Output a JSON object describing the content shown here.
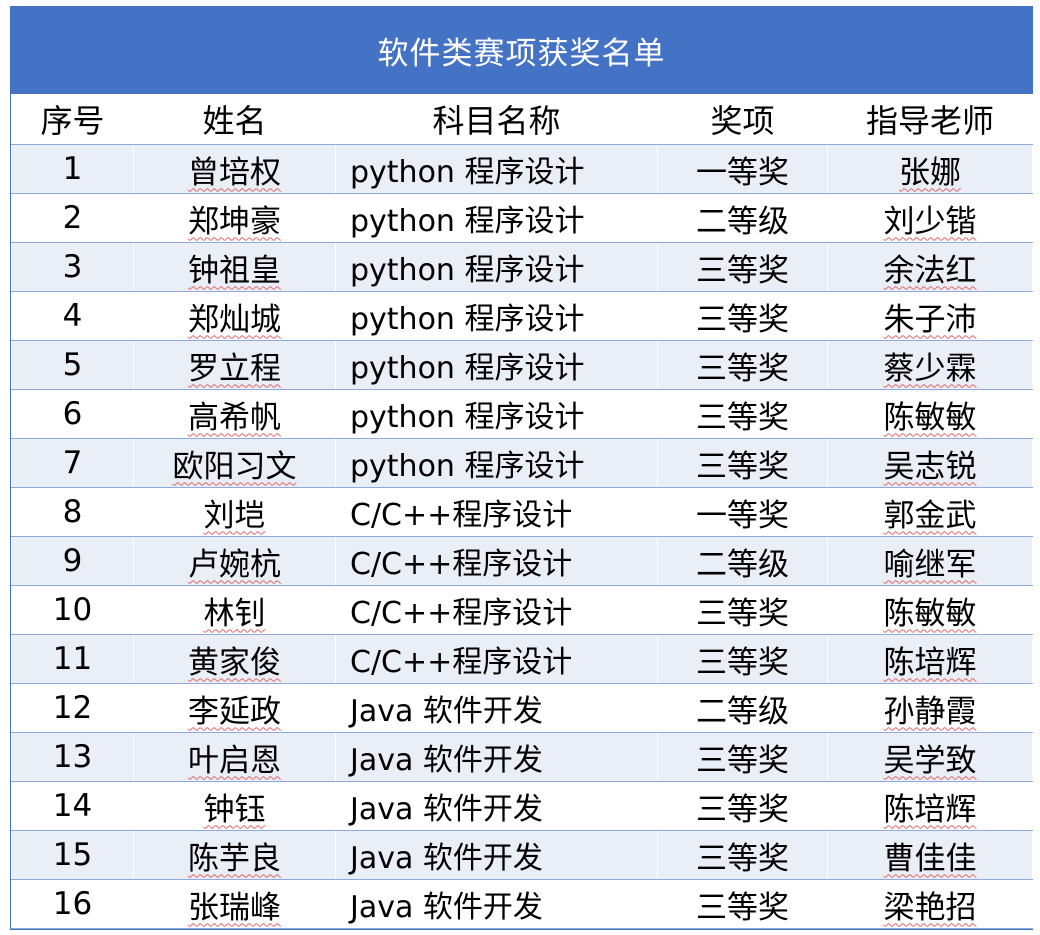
{
  "title": "软件类赛项获奖名单",
  "headers": [
    "序号",
    "姓名",
    "科目名称",
    "奖项",
    "指导老师"
  ],
  "rows": [
    {
      "no": "1",
      "name": "曾培权",
      "subject": "python 程序设计",
      "award": "一等奖",
      "teacher": "张娜"
    },
    {
      "no": "2",
      "name": "郑坤豪",
      "subject": "python 程序设计",
      "award": "二等级",
      "teacher": "刘少锴"
    },
    {
      "no": "3",
      "name": "钟祖皇",
      "subject": "python 程序设计",
      "award": "三等奖",
      "teacher": "余法红"
    },
    {
      "no": "4",
      "name": "郑灿城",
      "subject": "python 程序设计",
      "award": "三等奖",
      "teacher": "朱子沛"
    },
    {
      "no": "5",
      "name": "罗立程",
      "subject": "python 程序设计",
      "award": "三等奖",
      "teacher": "蔡少霖"
    },
    {
      "no": "6",
      "name": "高希帆",
      "subject": "python 程序设计",
      "award": "三等奖",
      "teacher": "陈敏敏"
    },
    {
      "no": "7",
      "name": "欧阳习文",
      "subject": "python 程序设计",
      "award": "三等奖",
      "teacher": "吴志锐"
    },
    {
      "no": "8",
      "name": "刘垲",
      "subject": "C/C++程序设计",
      "award": "一等奖",
      "teacher": "郭金武"
    },
    {
      "no": "9",
      "name": "卢婉杭",
      "subject": "C/C++程序设计",
      "award": "二等级",
      "teacher": "喻继军"
    },
    {
      "no": "10",
      "name": "林钊",
      "subject": "C/C++程序设计",
      "award": "三等奖",
      "teacher": "陈敏敏"
    },
    {
      "no": "11",
      "name": "黄家俊",
      "subject": "C/C++程序设计",
      "award": "三等奖",
      "teacher": "陈培辉"
    },
    {
      "no": "12",
      "name": "李延政",
      "subject": "Java 软件开发",
      "award": "二等级",
      "teacher": "孙静霞"
    },
    {
      "no": "13",
      "name": "叶启恩",
      "subject": "Java 软件开发",
      "award": "三等奖",
      "teacher": "吴学致"
    },
    {
      "no": "14",
      "name": "钟钰",
      "subject": "Java 软件开发",
      "award": "三等奖",
      "teacher": "陈培辉"
    },
    {
      "no": "15",
      "name": "陈芋良",
      "subject": "Java 软件开发",
      "award": "三等奖",
      "teacher": "曹佳佳"
    },
    {
      "no": "16",
      "name": "张瑞峰",
      "subject": "Java 软件开发",
      "award": "三等奖",
      "teacher": "梁艳招"
    }
  ]
}
